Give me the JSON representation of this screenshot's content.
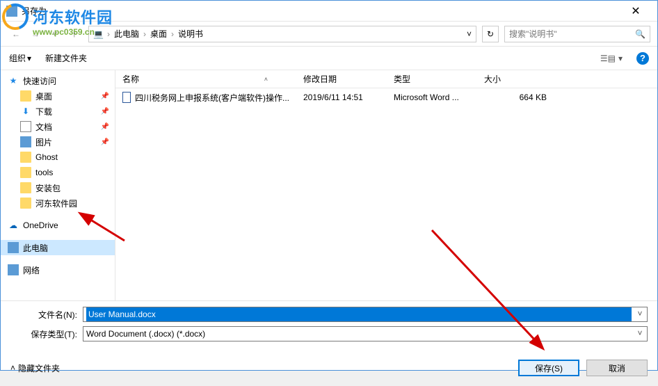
{
  "colors": {
    "accent": "#0078d7",
    "folder": "#ffd968",
    "arrow": "#d40000"
  },
  "window": {
    "title": "另存为"
  },
  "watermark": {
    "brand": "河东软件园",
    "url": "www.pc0359.cn"
  },
  "nav": {
    "breadcrumb": [
      "此电脑",
      "桌面",
      "说明书"
    ],
    "search_placeholder": "搜索\"说明书\""
  },
  "toolbar": {
    "organize": "组织",
    "new_folder": "新建文件夹",
    "help": "?"
  },
  "sidebar": {
    "items": [
      {
        "label": "快速访问",
        "icon": "star",
        "indent": false,
        "pin": false
      },
      {
        "label": "桌面",
        "icon": "folder",
        "indent": true,
        "pin": true
      },
      {
        "label": "下载",
        "icon": "download",
        "indent": true,
        "pin": true
      },
      {
        "label": "文档",
        "icon": "doc",
        "indent": true,
        "pin": true
      },
      {
        "label": "图片",
        "icon": "pic",
        "indent": true,
        "pin": true
      },
      {
        "label": "Ghost",
        "icon": "folder",
        "indent": true,
        "pin": false
      },
      {
        "label": "tools",
        "icon": "folder",
        "indent": true,
        "pin": false
      },
      {
        "label": "安装包",
        "icon": "folder",
        "indent": true,
        "pin": false
      },
      {
        "label": "河东软件园",
        "icon": "folder",
        "indent": true,
        "pin": false
      },
      {
        "label": "OneDrive",
        "icon": "cloud",
        "indent": false,
        "pin": false
      },
      {
        "label": "此电脑",
        "icon": "pc",
        "indent": false,
        "pin": false,
        "selected": true
      },
      {
        "label": "网络",
        "icon": "net",
        "indent": false,
        "pin": false
      }
    ]
  },
  "filelist": {
    "headers": {
      "name": "名称",
      "date": "修改日期",
      "type": "类型",
      "size": "大小"
    },
    "rows": [
      {
        "name": "四川税务网上申报系统(客户端软件)操作...",
        "date": "2019/6/11 14:51",
        "type": "Microsoft Word ...",
        "size": "664 KB"
      }
    ]
  },
  "fields": {
    "filename_label": "文件名(N):",
    "filename_value": "User Manual.docx",
    "filetype_label": "保存类型(T):",
    "filetype_value": "Word Document (.docx) (*.docx)"
  },
  "footer": {
    "hide_folders": "隐藏文件夹",
    "save": "保存(S)",
    "cancel": "取消"
  }
}
